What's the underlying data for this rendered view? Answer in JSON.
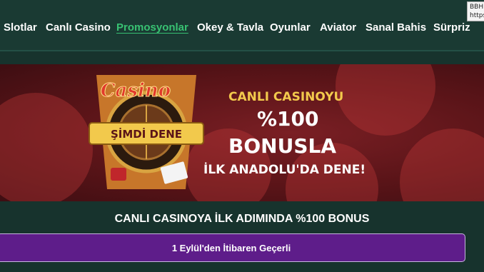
{
  "nav": {
    "items": [
      {
        "label": "Slotlar"
      },
      {
        "label": "Canlı Casino"
      },
      {
        "label": "Promosyonlar",
        "active": true
      },
      {
        "label": "Okey & Tavla"
      },
      {
        "label": "Oyunlar"
      },
      {
        "label": "Aviator"
      },
      {
        "label": "Sanal Bahis"
      },
      {
        "label": "Sürpriz"
      }
    ]
  },
  "tooltip": {
    "line1": "BBH",
    "line2": "https"
  },
  "banner": {
    "logo_text": "Casino",
    "logo_button": "ŞİMDİ DENE",
    "line1": "CANLI CASINOYU",
    "line2": "%100",
    "line3": "BONUSLA",
    "line4": "İLK ANADOLU'DA DENE!"
  },
  "headline": "CANLI CASINOYA İLK ADIMINDA %100 BONUS",
  "notice": "1 Eylül'den İtibaren Geçerli",
  "colors": {
    "background": "#17332d",
    "active_nav": "#38c172",
    "banner": "#5a1418",
    "gold": "#f2c94c",
    "notice_bg": "#5e1d8a"
  }
}
